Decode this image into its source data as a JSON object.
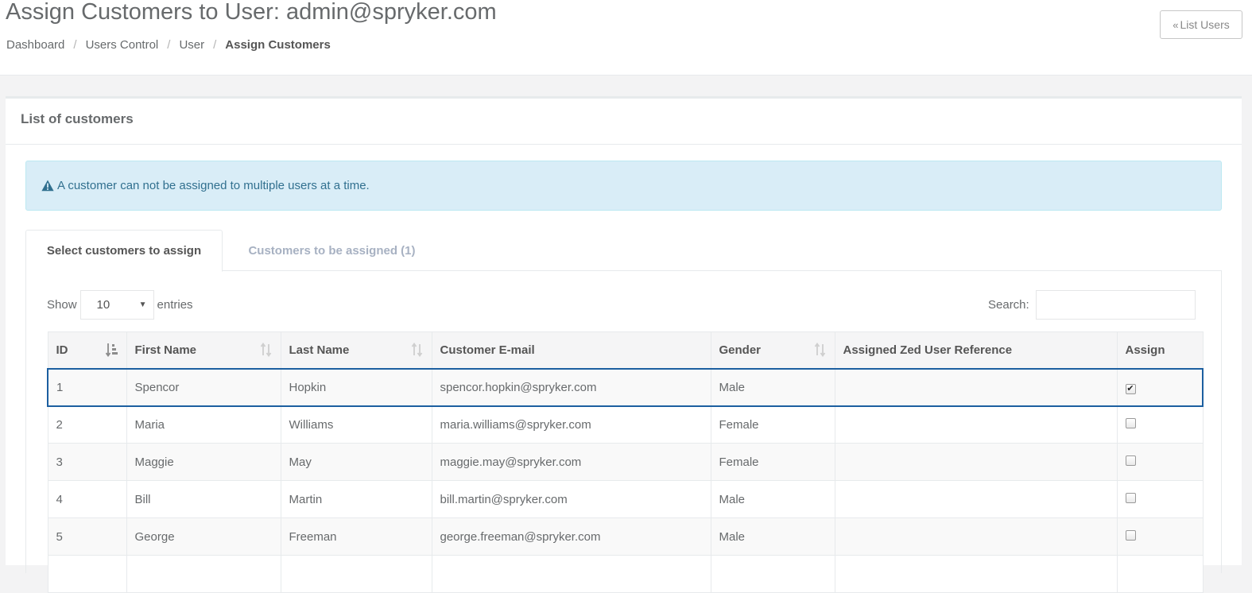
{
  "header": {
    "title": "Assign Customers to User: admin@spryker.com",
    "breadcrumb": [
      "Dashboard",
      "Users Control",
      "User",
      "Assign Customers"
    ],
    "breadcrumb_separator": "/",
    "list_users_button": "List Users"
  },
  "panel": {
    "title": "List of customers",
    "alert_text": "A customer can not be assigned to multiple users at a time.",
    "tabs": [
      {
        "label": "Select customers to assign",
        "active": true
      },
      {
        "label": "Customers to be assigned (1)",
        "active": false
      }
    ]
  },
  "table_controls": {
    "show_label": "Show",
    "entries_value": "10",
    "entries_label": "entries",
    "search_label": "Search:",
    "search_value": ""
  },
  "table": {
    "columns": [
      "ID",
      "First Name",
      "Last Name",
      "Customer E-mail",
      "Gender",
      "Assigned Zed User Reference",
      "Assign"
    ],
    "rows": [
      {
        "id": "1",
        "first_name": "Spencor",
        "last_name": "Hopkin",
        "email": "spencor.hopkin@spryker.com",
        "gender": "Male",
        "zed_ref": "",
        "assigned": true
      },
      {
        "id": "2",
        "first_name": "Maria",
        "last_name": "Williams",
        "email": "maria.williams@spryker.com",
        "gender": "Female",
        "zed_ref": "",
        "assigned": false
      },
      {
        "id": "3",
        "first_name": "Maggie",
        "last_name": "May",
        "email": "maggie.may@spryker.com",
        "gender": "Female",
        "zed_ref": "",
        "assigned": false
      },
      {
        "id": "4",
        "first_name": "Bill",
        "last_name": "Martin",
        "email": "bill.martin@spryker.com",
        "gender": "Male",
        "zed_ref": "",
        "assigned": false
      },
      {
        "id": "5",
        "first_name": "George",
        "last_name": "Freeman",
        "email": "george.freeman@spryker.com",
        "gender": "Male",
        "zed_ref": "",
        "assigned": false
      }
    ]
  },
  "colors": {
    "alert_bg": "#d9edf7",
    "alert_text": "#31708f",
    "selected_row_border": "#1c5fa0",
    "inactive_tab": "#a7b1c2"
  }
}
